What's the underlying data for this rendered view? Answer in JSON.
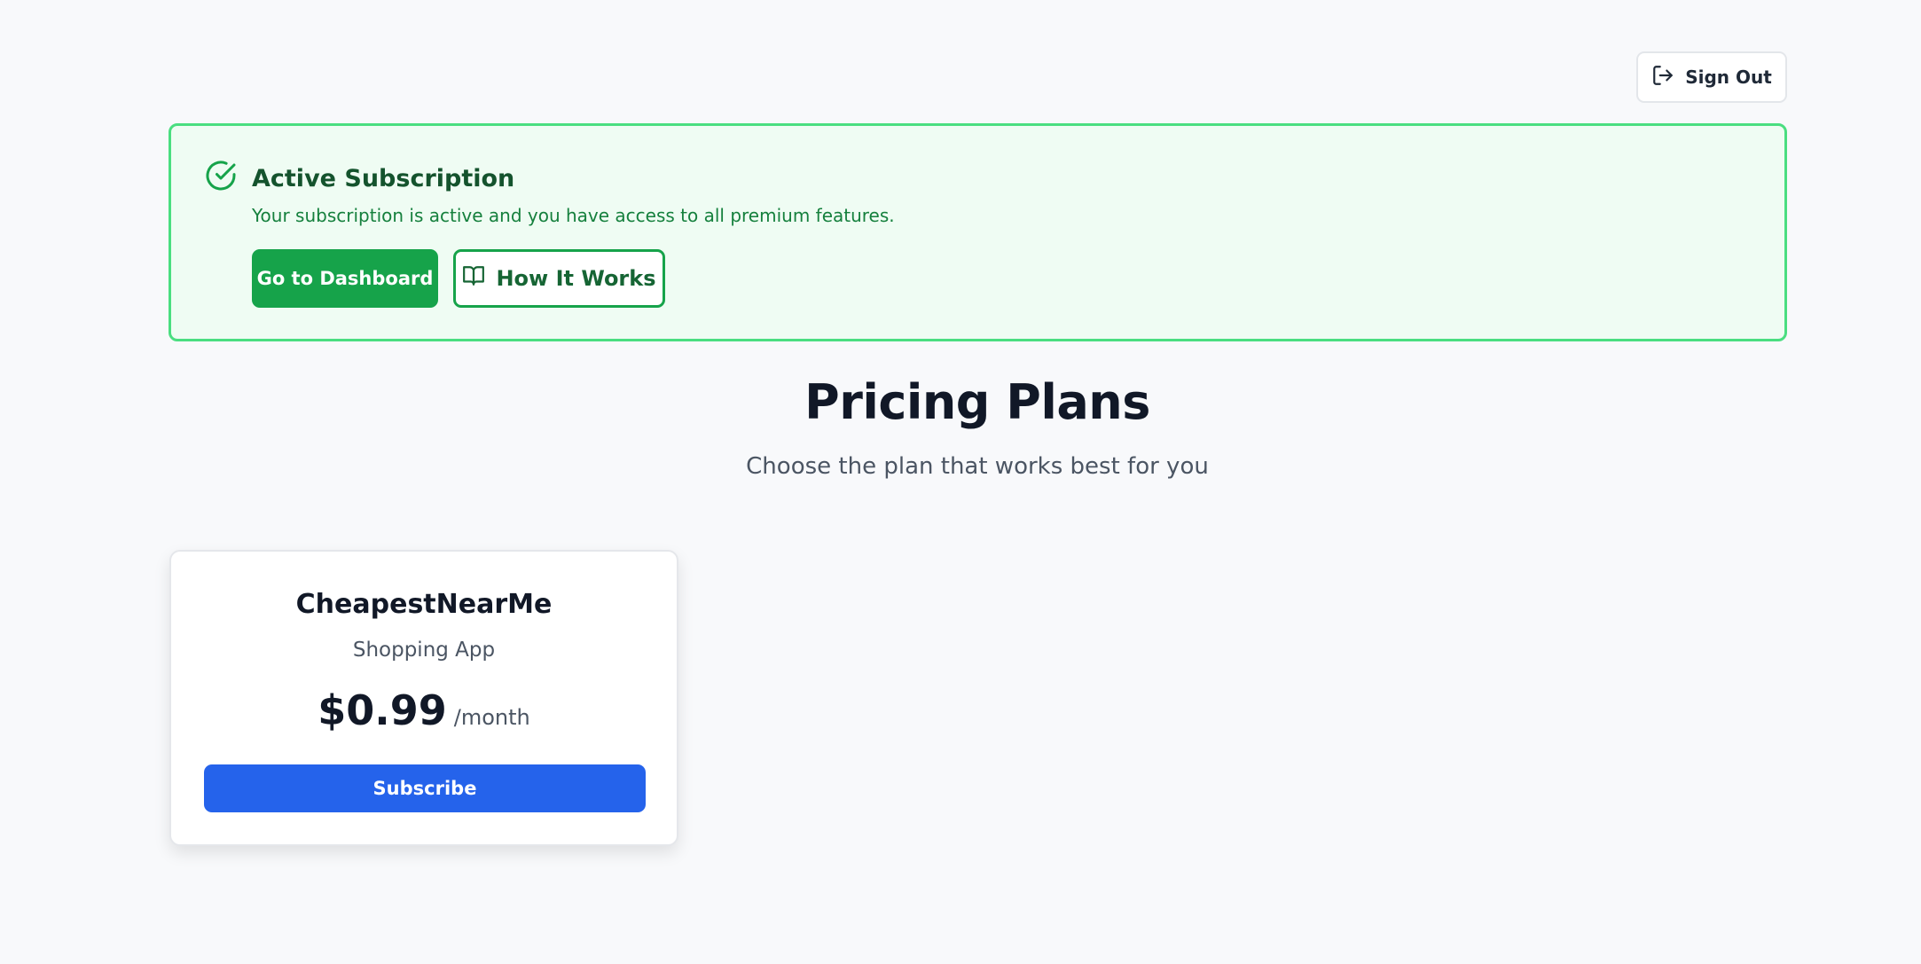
{
  "header": {
    "signout_label": "Sign Out",
    "signout_icon": "log-out-icon"
  },
  "banner": {
    "icon": "check-circle-icon",
    "title": "Active Subscription",
    "message": "Your subscription is active and you have access to all premium features.",
    "dashboard_label": "Go to Dashboard",
    "how_label": "How It Works",
    "how_icon": "book-open-icon",
    "colors": {
      "accent": "#16a34a",
      "background": "#effcf3",
      "border": "#4ade80"
    }
  },
  "pricing": {
    "title": "Pricing Plans",
    "subtitle": "Choose the plan that works best for you",
    "plans": [
      {
        "name": "CheapestNearMe",
        "description": "Shopping App",
        "price": "$0.99",
        "period": "/month",
        "button_label": "Subscribe",
        "button_color": "#2563eb"
      }
    ]
  }
}
